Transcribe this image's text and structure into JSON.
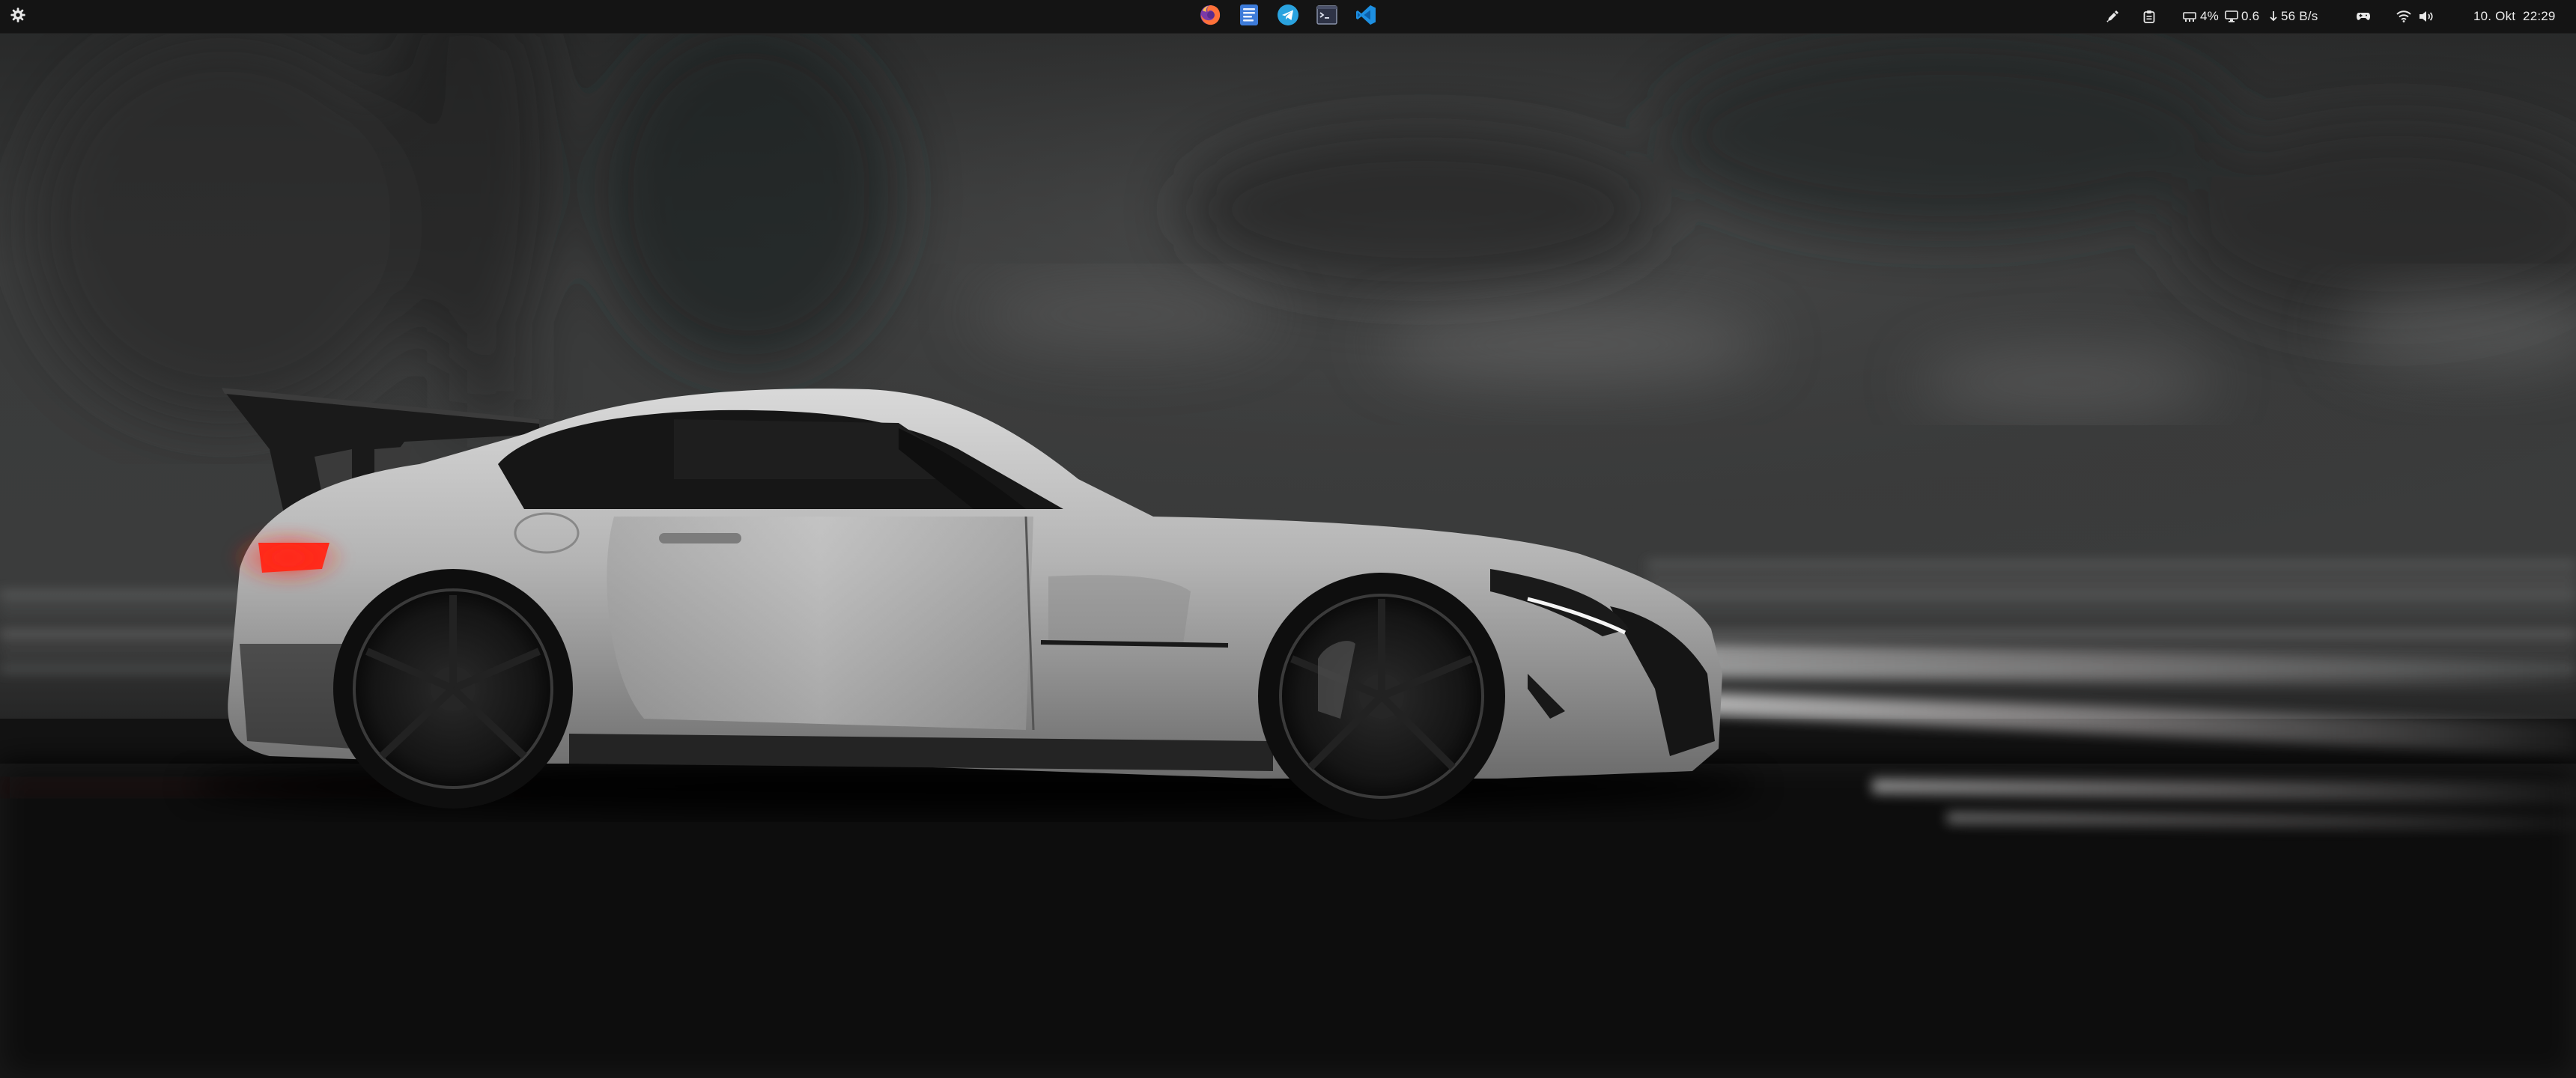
{
  "desktop": {
    "wallpaper": {
      "subject": "silver-sports-car-side-profile",
      "colors": {
        "sky": "#3a3b3b",
        "ground": "#0f0f0f",
        "car_body": "#bdbdbd",
        "tail_light": "#ff2a1a",
        "headlight": "#f5f5f5"
      }
    }
  },
  "top_bar": {
    "activities_icon": "gear-icon",
    "dock": [
      {
        "app": "Firefox",
        "icon": "firefox-icon",
        "color": "#ff7139"
      },
      {
        "app": "Text Editor",
        "icon": "text-editor-icon",
        "color": "#3d7bd9"
      },
      {
        "app": "Telegram",
        "icon": "telegram-icon",
        "color": "#2aa3df"
      },
      {
        "app": "Terminal",
        "icon": "terminal-icon",
        "color": "#2e3346"
      },
      {
        "app": "Visual Studio Code",
        "icon": "vscode-icon",
        "color": "#1d8fe1"
      }
    ],
    "tray": {
      "color_picker_icon": "eyedropper-icon",
      "clipboard_icon": "clipboard-icon",
      "cpu": {
        "icon": "cpu-icon",
        "text": "4%"
      },
      "load": {
        "icon": "monitor-icon",
        "text": "0.6"
      },
      "network": {
        "icon": "download-arrow-icon",
        "text": "56 B/s"
      },
      "gamepad_icon": "gamepad-icon",
      "wifi_icon": "wifi-icon",
      "volume_icon": "volume-icon",
      "clock": "10. Okt  22:29"
    }
  }
}
